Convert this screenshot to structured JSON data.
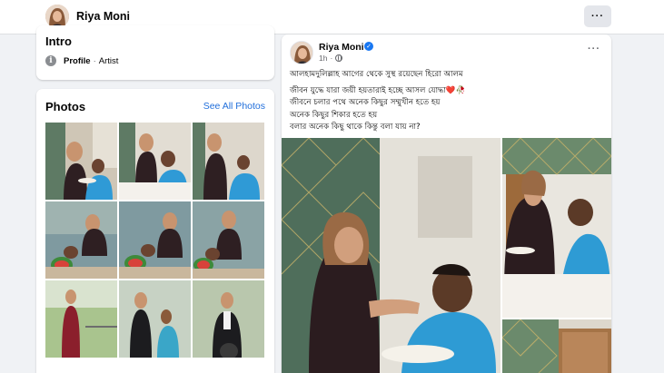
{
  "header": {
    "profile_name": "Riya Moni",
    "more_label": "···"
  },
  "intro": {
    "title": "Intro",
    "row_label": "Profile",
    "row_sep": "·",
    "row_value": "Artist",
    "icon": "info-icon"
  },
  "photos": {
    "title": "Photos",
    "see_all": "See All Photos",
    "count": 9
  },
  "post": {
    "author": "Riya Moni",
    "verified": true,
    "time": "1h",
    "time_sep": "·",
    "more_label": "···",
    "lines": [
      "আলহামদুলিল্লাহ আগের থেকে সুস্থ রয়েছেন হিরো আলম",
      "জীবন যুদ্ধে যারা জয়ী হয়তারাই হচ্ছে আসল যোদ্ধা❤️🥀",
      "জীবনে চলার পথে অনেক কিছুর সম্মুখীন হতে হয়",
      "অনেক কিছুর শিকার হতে হয়",
      "বলার অনেক কিছু থাকে কিন্তু বলা যায় না?"
    ],
    "image_count": 3
  },
  "colors": {
    "page_bg": "#f0f2f5",
    "card_bg": "#ffffff",
    "link": "#216fdb",
    "verified": "#1877f2",
    "secondary_text": "#65676b"
  }
}
